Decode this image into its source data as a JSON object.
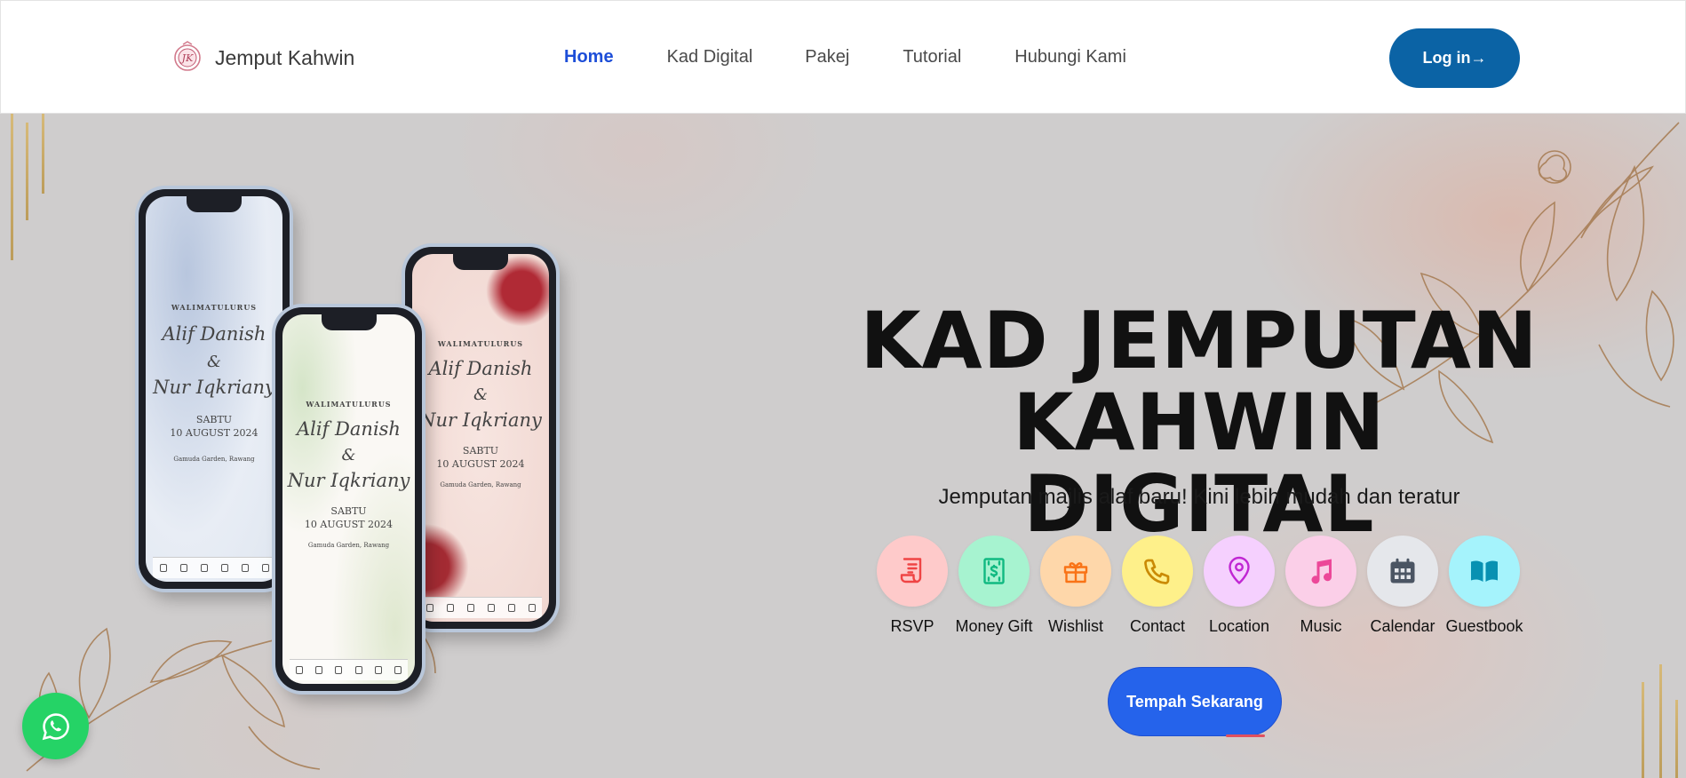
{
  "header": {
    "brand": "Jemput Kahwin",
    "nav": [
      {
        "label": "Home",
        "active": true
      },
      {
        "label": "Kad Digital",
        "active": false
      },
      {
        "label": "Pakej",
        "active": false
      },
      {
        "label": "Tutorial",
        "active": false
      },
      {
        "label": "Hubungi Kami",
        "active": false
      }
    ],
    "login_label": "Log in→"
  },
  "hero": {
    "title": "KAD JEMPUTAN\nKAHWIN  DIGITAL",
    "subtitle": "Jemputan majlis alaf baru! Kini lebih mudah dan teratur",
    "features": [
      {
        "label": "RSVP",
        "icon": "receipt-icon",
        "bg": "#fecaca",
        "color": "#ef4444"
      },
      {
        "label": "Money Gift",
        "icon": "money-icon",
        "bg": "#a7f3d0",
        "color": "#10b981"
      },
      {
        "label": "Wishlist",
        "icon": "gift-icon",
        "bg": "#fed7aa",
        "color": "#f97316"
      },
      {
        "label": "Contact",
        "icon": "phone-icon",
        "bg": "#fef08a",
        "color": "#ca8a04"
      },
      {
        "label": "Location",
        "icon": "location-pin-icon",
        "bg": "#f5d0fe",
        "color": "#c026d3"
      },
      {
        "label": "Music",
        "icon": "music-note-icon",
        "bg": "#fbcfe8",
        "color": "#ec4899"
      },
      {
        "label": "Calendar",
        "icon": "calendar-icon",
        "bg": "#e5e7eb",
        "color": "#4b5563"
      },
      {
        "label": "Guestbook",
        "icon": "book-icon",
        "bg": "#a5f3fc",
        "color": "#0891b2"
      }
    ],
    "book_label": "Tempah Sekarang"
  },
  "phones": {
    "heading": "WALIMATULURUS",
    "name1": "Alif Danish",
    "amp": "&",
    "name2": "Nur Iqkriany",
    "day": "SABTU",
    "date": "10 AUGUST 2024",
    "venue": "Gamuda Garden, Rawang"
  },
  "whatsapp": {
    "icon": "whatsapp-icon"
  }
}
